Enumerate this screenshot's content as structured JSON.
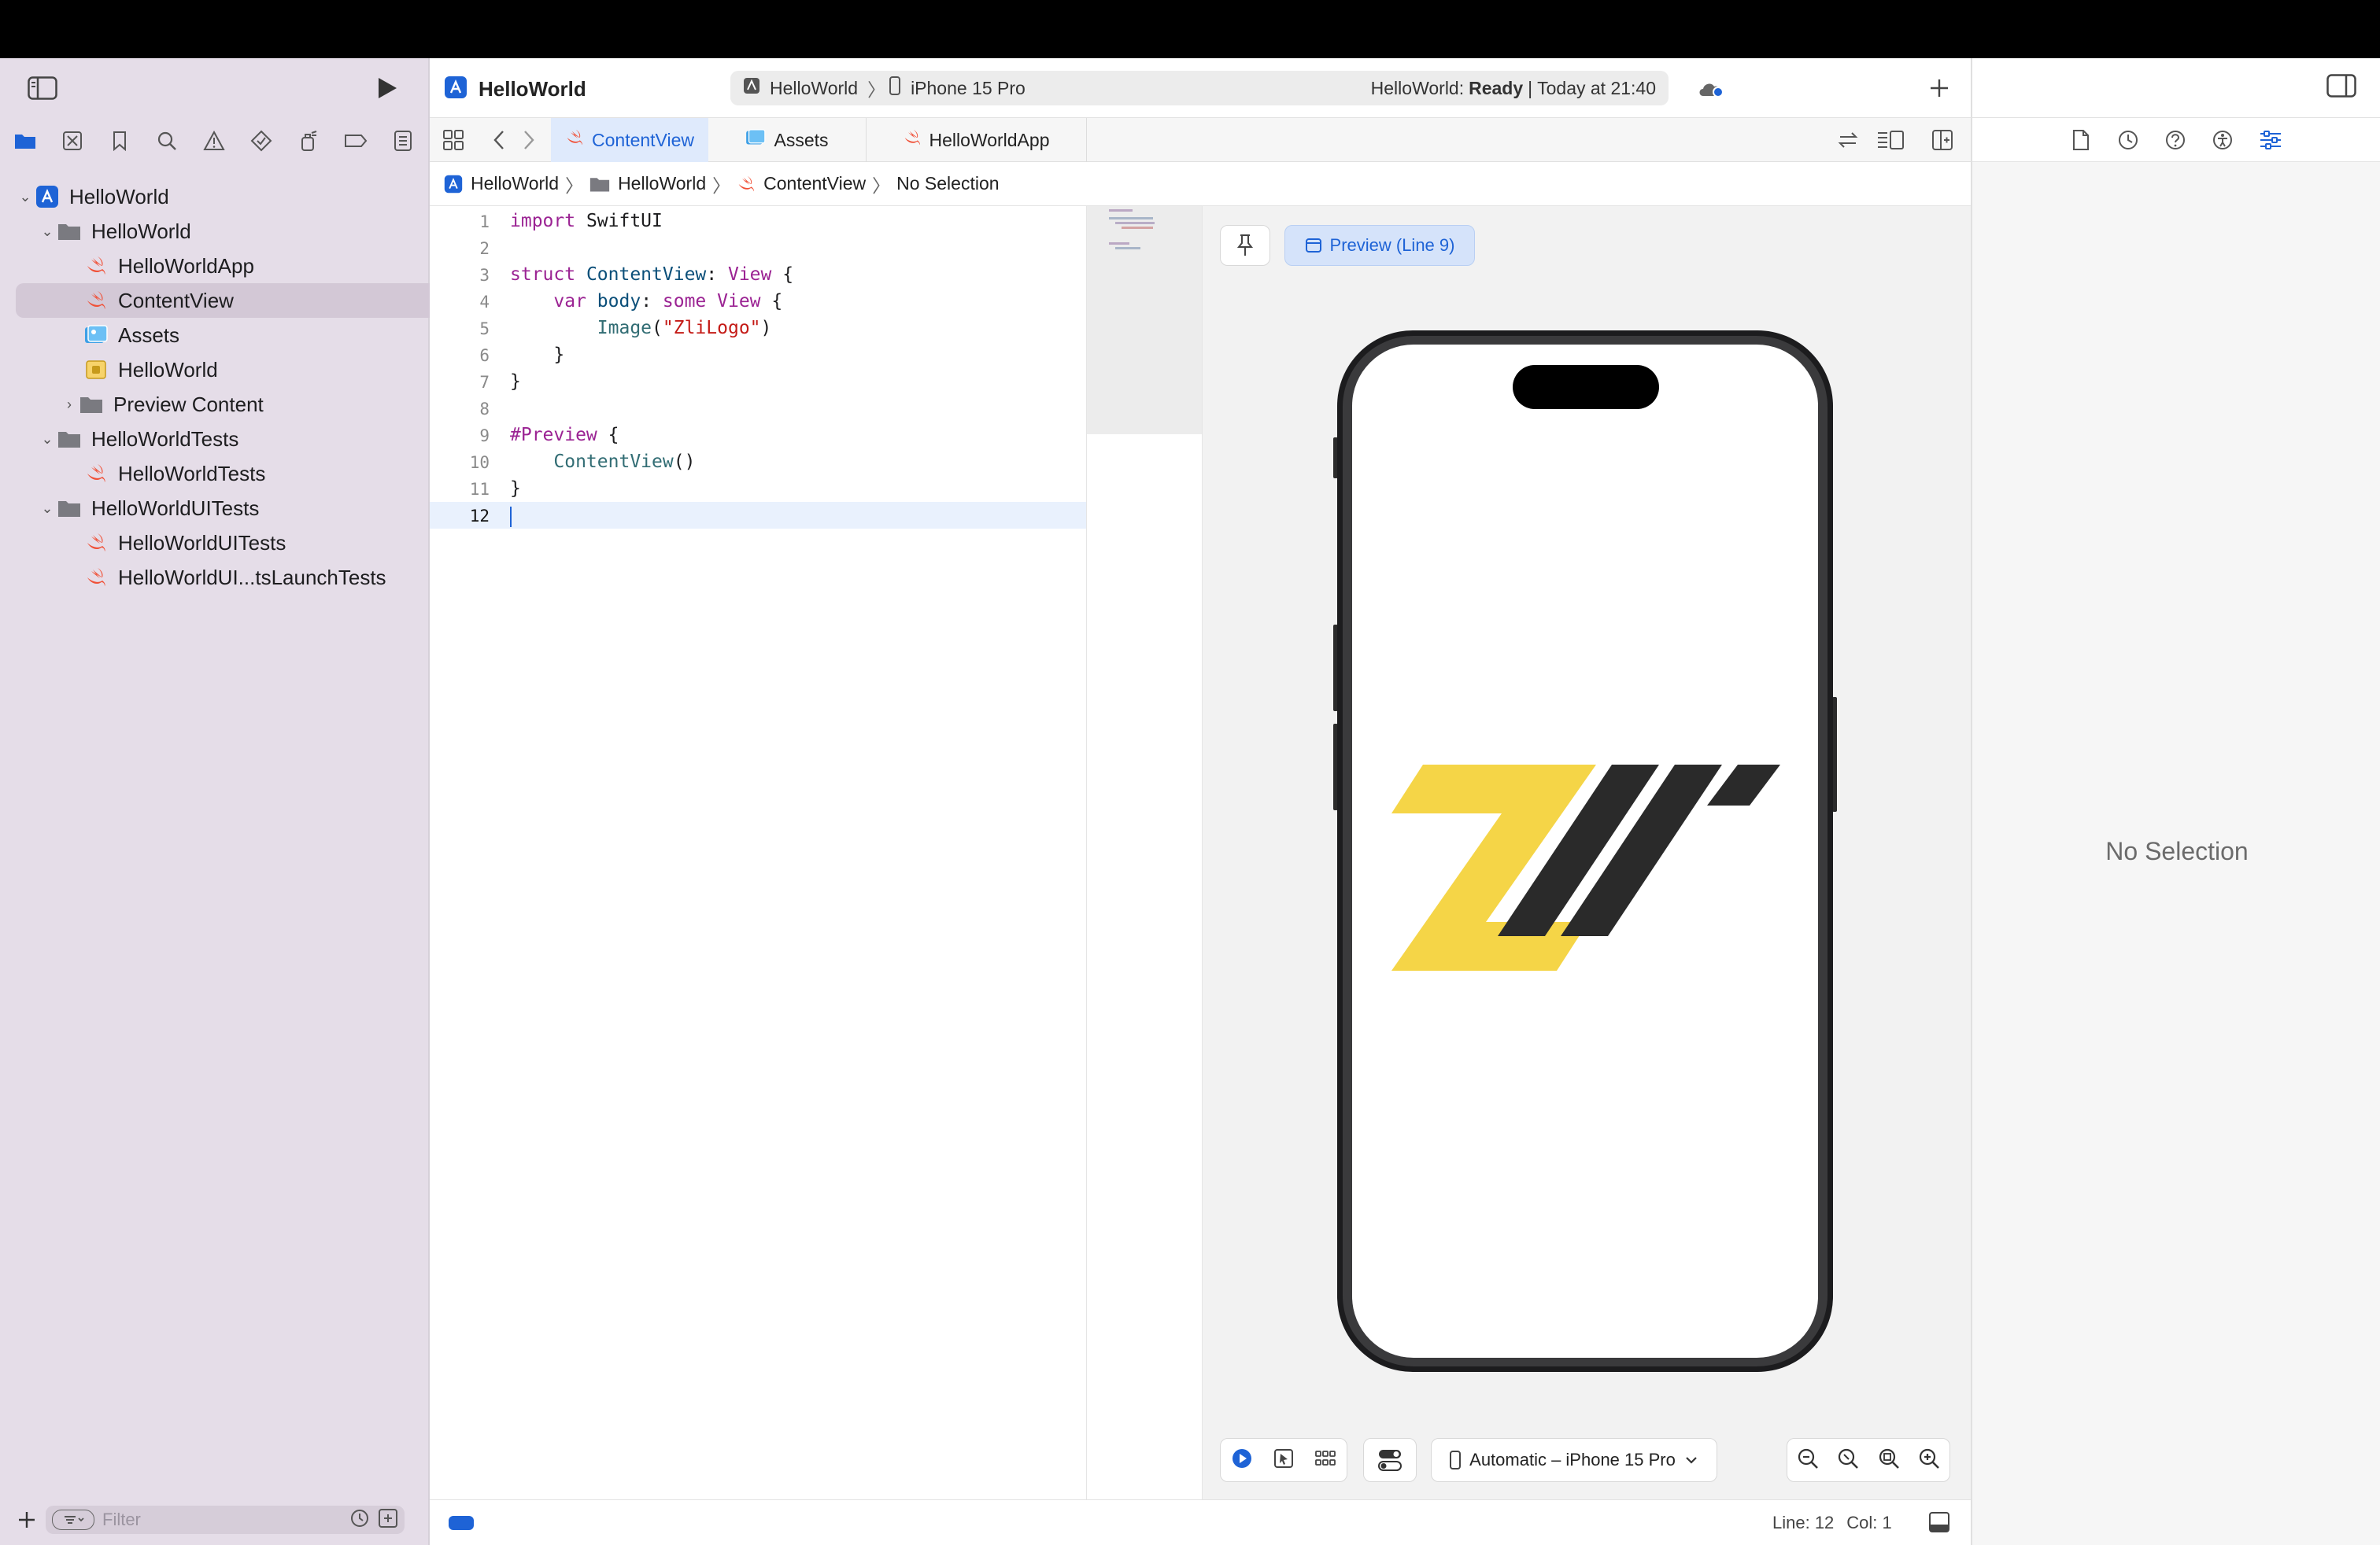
{
  "window": {
    "scheme_project": "HelloWorld",
    "scheme_device": "iPhone 15 Pro",
    "status_project": "HelloWorld:",
    "status_state": "Ready",
    "status_time": "| Today at 21:40"
  },
  "navigator": {
    "items": [
      {
        "label": "HelloWorld",
        "kind": "project",
        "chevron": "⌄"
      },
      {
        "label": "HelloWorld",
        "kind": "folder",
        "chevron": "⌄"
      },
      {
        "label": "HelloWorldApp",
        "kind": "swift",
        "chevron": ""
      },
      {
        "label": "ContentView",
        "kind": "swift",
        "chevron": "",
        "selected": true
      },
      {
        "label": "Assets",
        "kind": "assets",
        "chevron": ""
      },
      {
        "label": "HelloWorld",
        "kind": "entitlements",
        "chevron": ""
      },
      {
        "label": "Preview Content",
        "kind": "folder",
        "chevron": "›"
      },
      {
        "label": "HelloWorldTests",
        "kind": "folder",
        "chevron": "⌄"
      },
      {
        "label": "HelloWorldTests",
        "kind": "swift",
        "chevron": ""
      },
      {
        "label": "HelloWorldUITests",
        "kind": "folder",
        "chevron": "⌄"
      },
      {
        "label": "HelloWorldUITests",
        "kind": "swift",
        "chevron": ""
      },
      {
        "label": "HelloWorldUI...tsLaunchTests",
        "kind": "swift",
        "chevron": ""
      }
    ],
    "filter_placeholder": "Filter"
  },
  "tabs": [
    {
      "label": "ContentView",
      "active": true
    },
    {
      "label": "Assets",
      "active": false
    },
    {
      "label": "HelloWorldApp",
      "active": false
    }
  ],
  "jumpbar": {
    "project": "HelloWorld",
    "folder": "HelloWorld",
    "file": "ContentView",
    "selection": "No Selection",
    "sep": "〉"
  },
  "code": {
    "line_numbers": [
      "1",
      "2",
      "3",
      "4",
      "5",
      "6",
      "7",
      "8",
      "9",
      "10",
      "11",
      "12"
    ],
    "l1_kw": "import",
    "l1_rest": " SwiftUI",
    "l3_kw": "struct",
    "l3_name": " ContentView",
    "l3_colon": ": ",
    "l3_type": "View",
    "l3_brace": " {",
    "l4_indent": "    ",
    "l4_kw": "var",
    "l4_prop": " body",
    "l4_colon": ": ",
    "l4_kw2": "some",
    "l4_type": " View",
    "l4_brace": " {",
    "l5_indent": "        ",
    "l5_fn": "Image",
    "l5_open": "(",
    "l5_str": "\"ZliLogo\"",
    "l5_close": ")",
    "l6": "    }",
    "l7": "}",
    "l9_kw": "#Preview",
    "l9_brace": " {",
    "l10_indent": "    ",
    "l10_fn": "ContentView",
    "l10_paren": "()",
    "l11": "}"
  },
  "preview": {
    "label": "Preview (Line 9)",
    "device_menu": "Automatic – iPhone 15 Pro"
  },
  "statusbar": {
    "line": "Line: 12",
    "col": "Col: 1"
  },
  "inspector": {
    "empty": "No Selection"
  },
  "colors": {
    "accent": "#1e63d6",
    "logo_yellow": "#f5d547",
    "logo_dark": "#2a2a2a",
    "swift_orange": "#f05138"
  }
}
